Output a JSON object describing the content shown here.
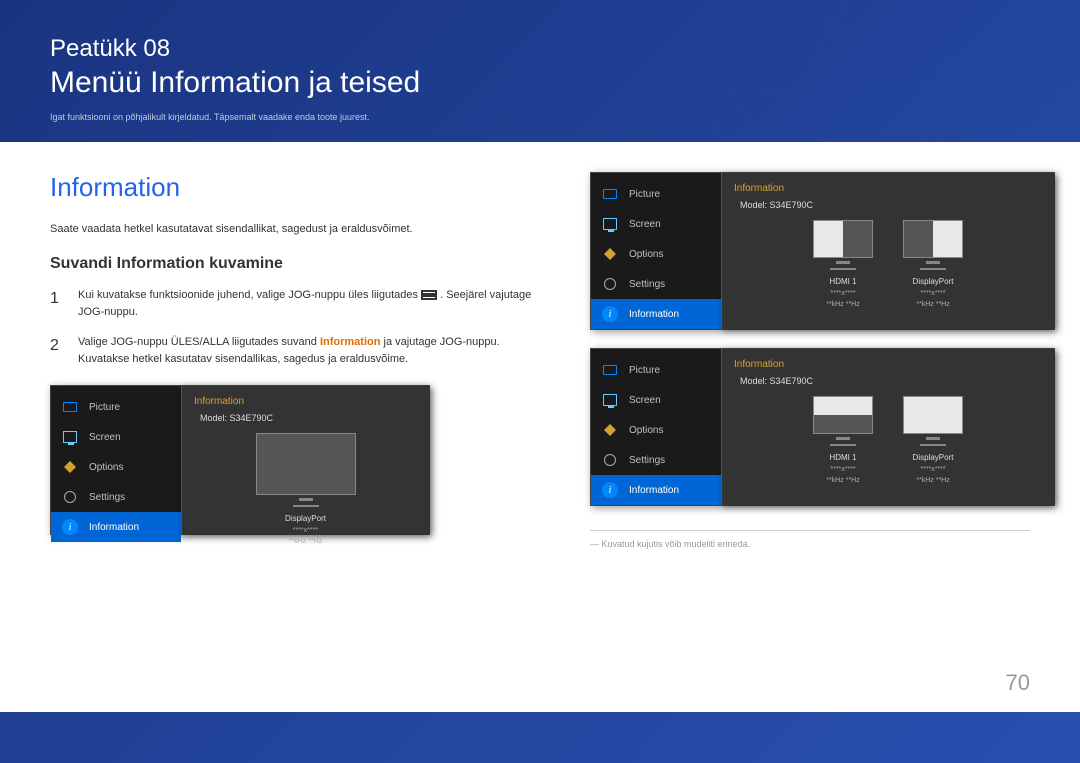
{
  "header": {
    "chapter": "Peatükk 08",
    "title": "Menüü Information ja teised",
    "subtitle": "Igat funktsiooni on põhjalikult kirjeldatud. Täpsemalt vaadake enda toote juurest."
  },
  "section": {
    "heading": "Information",
    "description": "Saate vaadata hetkel kasutatavat sisendallikat, sagedust ja eraldusvõimet.",
    "subheading": "Suvandi Information kuvamine"
  },
  "steps": [
    {
      "num": "1",
      "pre": "Kui kuvatakse funktsioonide juhend, valige JOG-nuppu üles liigutades ",
      "post": ". Seejärel vajutage JOG-nuppu."
    },
    {
      "num": "2",
      "pre": "Valige JOG-nuppu ÜLES/ALLA liigutades suvand ",
      "highlight": "Information",
      "post": " ja vajutage JOG-nuppu. Kuvatakse hetkel kasutatav sisendallikas, sagedus ja eraldusvõime."
    }
  ],
  "osd": {
    "nav": [
      "Picture",
      "Screen",
      "Options",
      "Settings",
      "Information"
    ],
    "panel_title": "Information",
    "model": "Model: S34E790C",
    "ports": {
      "dp": "DisplayPort",
      "hdmi": "HDMI 1",
      "res": "****x****",
      "freq": "**kHz **Hz"
    }
  },
  "footnote": "― Kuvatud kujutis võib mudeliti erineda.",
  "page": "70"
}
